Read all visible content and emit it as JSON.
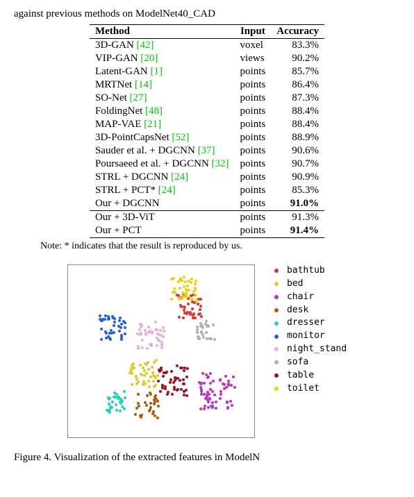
{
  "top_caption": "against previous methods on ModelNet40_CAD",
  "table": {
    "headers": {
      "method": "Method",
      "input": "Input",
      "accuracy": "Accuracy"
    },
    "rows": [
      {
        "method": "3D-GAN ",
        "cite": "[42]",
        "input": "voxel",
        "accuracy": "83.3%",
        "bold": false
      },
      {
        "method": "VIP-GAN ",
        "cite": "[20]",
        "input": "views",
        "accuracy": "90.2%",
        "bold": false
      },
      {
        "method": "Latent-GAN ",
        "cite": "[1]",
        "input": "points",
        "accuracy": "85.7%",
        "bold": false
      },
      {
        "method": "MRTNet ",
        "cite": "[14]",
        "input": "points",
        "accuracy": "86.4%",
        "bold": false
      },
      {
        "method": "SO-Net ",
        "cite": "[27]",
        "input": "points",
        "accuracy": "87.3%",
        "bold": false
      },
      {
        "method": "FoldingNet ",
        "cite": "[48]",
        "input": "points",
        "accuracy": "88.4%",
        "bold": false
      },
      {
        "method": "MAP-VAE ",
        "cite": "[21]",
        "input": "points",
        "accuracy": "88.4%",
        "bold": false
      },
      {
        "method": "3D-PointCapsNet ",
        "cite": "[52]",
        "input": "points",
        "accuracy": "88.9%",
        "bold": false
      },
      {
        "method": "Sauder et al. + DGCNN ",
        "cite": "[37]",
        "input": "points",
        "accuracy": "90.6%",
        "bold": false
      },
      {
        "method": "Poursaeed et al. + DGCNN ",
        "cite": "[32]",
        "input": "points",
        "accuracy": "90.7%",
        "bold": false
      },
      {
        "method": "STRL + DGCNN ",
        "cite": "[24]",
        "input": "points",
        "accuracy": "90.9%",
        "bold": false
      },
      {
        "method": "STRL + PCT* ",
        "cite": "[24]",
        "input": "points",
        "accuracy": "85.3%",
        "bold": false
      },
      {
        "method": "Our + DGCNN",
        "cite": "",
        "input": "points",
        "accuracy": "91.0%",
        "bold": true
      },
      {
        "method": "Our + 3D-ViT",
        "cite": "",
        "input": "points",
        "accuracy": "91.3%",
        "bold": false
      },
      {
        "method": "Our + PCT",
        "cite": "",
        "input": "points",
        "accuracy": "91.4%",
        "bold": true
      }
    ],
    "section_breaks": [
      0,
      13,
      15
    ]
  },
  "note": "Note: * indicates that the result is reproduced by us.",
  "chart_data": {
    "type": "scatter",
    "title": "",
    "xlabel": "",
    "ylabel": "",
    "legend_position": "right",
    "xrange": [
      0,
      268
    ],
    "yrange": [
      0,
      248
    ],
    "series": [
      {
        "name": "bathtub",
        "color": "#e03030",
        "cluster_center": [
          172,
          58
        ],
        "spread": 18,
        "n": 38
      },
      {
        "name": "bed",
        "color": "#e4c820",
        "cluster_center": [
          108,
          155
        ],
        "spread": 22,
        "n": 42
      },
      {
        "name": "chair",
        "color": "#c030c8",
        "cluster_center": [
          212,
          180
        ],
        "spread": 26,
        "n": 60
      },
      {
        "name": "desk",
        "color": "#b55a00",
        "cluster_center": [
          110,
          200
        ],
        "spread": 18,
        "n": 30
      },
      {
        "name": "dresser",
        "color": "#20d0c0",
        "cluster_center": [
          66,
          195
        ],
        "spread": 16,
        "n": 30
      },
      {
        "name": "monitor",
        "color": "#2060e0",
        "cluster_center": [
          62,
          88
        ],
        "spread": 18,
        "n": 40
      },
      {
        "name": "night_stand",
        "color": "#e8b0d8",
        "cluster_center": [
          116,
          100
        ],
        "spread": 20,
        "n": 42
      },
      {
        "name": "sofa",
        "color": "#b0b0b0",
        "cluster_center": [
          196,
          92
        ],
        "spread": 14,
        "n": 30
      },
      {
        "name": "table",
        "color": "#a01020",
        "cluster_center": [
          150,
          165
        ],
        "spread": 22,
        "n": 48
      },
      {
        "name": "toilet",
        "color": "#f0d000",
        "cluster_center": [
          165,
          32
        ],
        "spread": 18,
        "n": 40
      }
    ]
  },
  "fig_caption_prefix": "Figure 4. Visualization of the extracted features in ModelN"
}
